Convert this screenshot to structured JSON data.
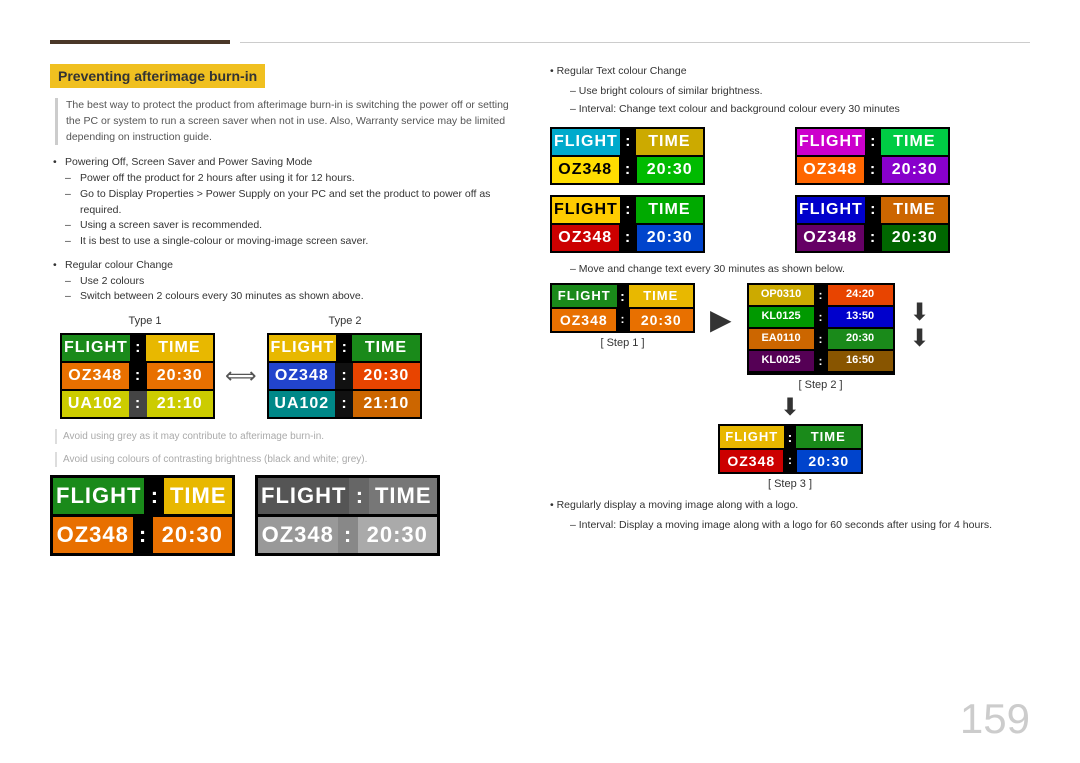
{
  "page": {
    "number": "159",
    "top_line": ""
  },
  "section": {
    "title": "Preventing afterimage burn-in",
    "intro": "The best way to protect the product from afterimage burn-in is switching the power off or setting the PC or system to run a screen saver when not in use. Also, Warranty service may be limited depending on instruction guide.",
    "bullets": [
      {
        "text": "Powering Off, Screen Saver and Power Saving Mode",
        "dashes": [
          "Power off the product for 2 hours after using it for 12 hours.",
          "Go to Display Properties > Power Supply on your PC and set the product to power off as required.",
          "Using a screen saver is recommended.",
          "It is best to use a single-colour or moving-image screen saver."
        ]
      },
      {
        "text": "Regular colour Change",
        "dashes": [
          "Use 2 colours",
          "Switch between 2 colours every 30 minutes as shown above."
        ]
      }
    ],
    "type1_label": "Type 1",
    "type2_label": "Type 2",
    "type1_board": {
      "header": [
        "FLIGHT",
        ":",
        "TIME"
      ],
      "rows": [
        [
          "OZ348",
          ":",
          "20:30"
        ],
        [
          "UA102",
          ":",
          "21:10"
        ]
      ]
    },
    "type2_board": {
      "header": [
        "FLIGHT",
        ":",
        "TIME"
      ],
      "rows": [
        [
          "OZ348",
          ":",
          "20:30"
        ],
        [
          "UA102",
          ":",
          "21:10"
        ]
      ]
    },
    "avoid_texts": [
      "Avoid using grey as it may contribute to afterimage burn-in.",
      "Avoid using colours of contrasting brightness (black and white; grey)."
    ],
    "bottom_boards": [
      {
        "type": "green",
        "header": [
          "FLIGHT",
          ":",
          "TIME"
        ],
        "row": [
          "OZ348",
          ":",
          "20:30"
        ]
      },
      {
        "type": "grey",
        "header": [
          "FLIGHT",
          ":",
          "TIME"
        ],
        "row": [
          "OZ348",
          ":",
          "20:30"
        ]
      }
    ]
  },
  "right": {
    "bullet": "Regular Text colour Change",
    "dashes": [
      "Use bright colours of similar brightness.",
      "Interval: Change text colour and background colour every 30 minutes"
    ],
    "color_boards_label": "",
    "move_text": "Move and change text every 30 minutes as shown below.",
    "step1_label": "[ Step 1 ]",
    "step2_label": "[ Step 2 ]",
    "step3_label": "[ Step 3 ]",
    "step1_board": {
      "header": [
        "FLIGHT",
        ":",
        "TIME"
      ],
      "row": [
        "OZ348",
        ":",
        "20:30"
      ]
    },
    "step2_boards": [
      [
        "OP0310",
        ":",
        "24:20"
      ],
      [
        "KL0125",
        ":",
        "13:50"
      ],
      [
        "EA0110",
        ":",
        "20:30"
      ],
      [
        "KL0025",
        ":",
        "16:50"
      ]
    ],
    "step3_board": {
      "header": [
        "FLIGHT",
        ":",
        "TIME"
      ],
      "row": [
        "OZ348",
        ":",
        "20:30"
      ]
    },
    "bottom_bullet": "Regularly display a moving image along with a logo.",
    "bottom_dash": "Interval: Display a moving image along with a logo for 60 seconds after using for 4 hours."
  }
}
